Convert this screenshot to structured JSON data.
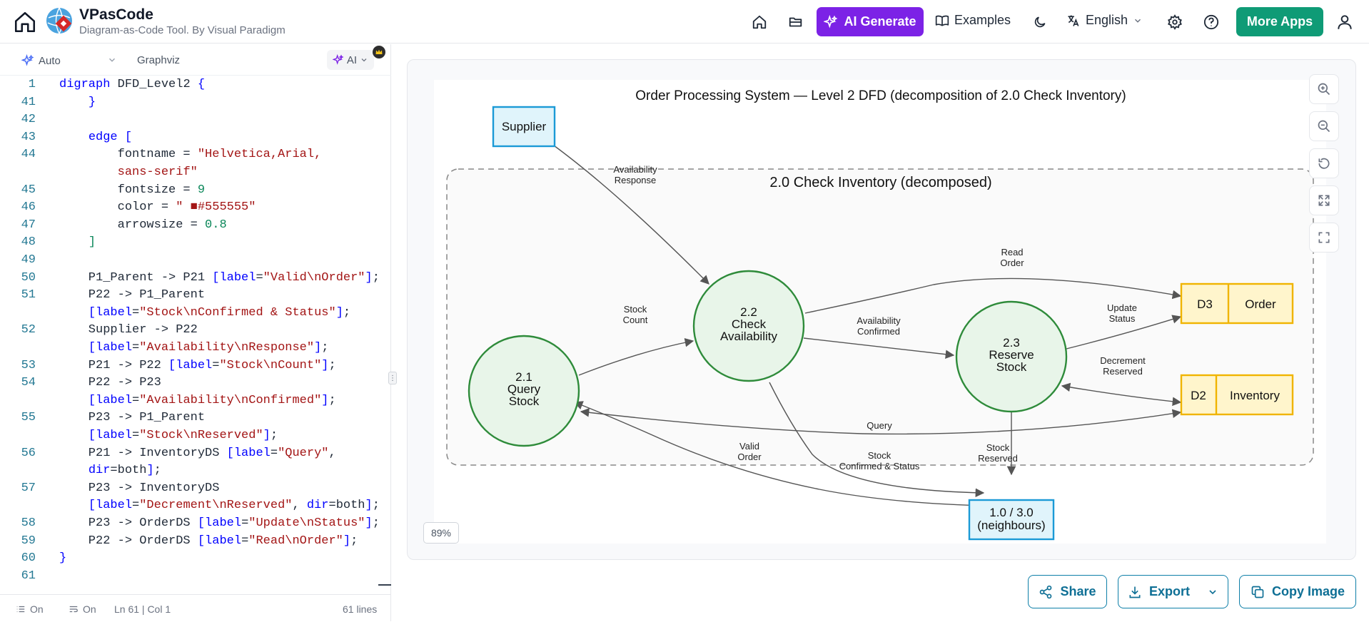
{
  "header": {
    "title": "VPasCode",
    "subtitle": "Diagram-as-Code Tool. By Visual Paradigm",
    "ai_generate": "AI Generate",
    "examples": "Examples",
    "language": "English",
    "more_apps": "More Apps",
    "accent_color": "#7c22e6",
    "more_apps_color": "#0f9b76"
  },
  "editor": {
    "mode": "Auto",
    "engine": "Graphviz",
    "ai": "AI",
    "lines": [
      {
        "n": "1",
        "html": "<span class=\"k\">digraph</span> DFD_Level2 <span class=\"k\">{</span>"
      },
      {
        "n": "41",
        "html": "    <span class=\"k\">}</span>"
      },
      {
        "n": "42",
        "html": ""
      },
      {
        "n": "43",
        "html": "    <span class=\"k\">edge</span> <span class=\"k\">[</span>"
      },
      {
        "n": "44",
        "html": "        fontname = <span class=\"s\">\"Helvetica,Arial,</span>"
      },
      {
        "n": "",
        "html": "        <span class=\"s\">sans-serif\"</span>"
      },
      {
        "n": "45",
        "html": "        fontsize = <span class=\"n\">9</span>"
      },
      {
        "n": "46",
        "html": "        color = <span class=\"s\">\" ■#555555\"</span>"
      },
      {
        "n": "47",
        "html": "        arrowsize = <span class=\"n\">0.8</span>"
      },
      {
        "n": "48",
        "html": "    <span class=\"n\">]</span>"
      },
      {
        "n": "49",
        "html": ""
      },
      {
        "n": "50",
        "html": "    P1_Parent -> P21 <span class=\"k\">[</span><span class=\"at\">label</span>=<span class=\"s\">\"Valid\\nOrder\"</span><span class=\"k\">]</span>;"
      },
      {
        "n": "51",
        "html": "    P22 -> P1_Parent"
      },
      {
        "n": "",
        "html": "    <span class=\"k\">[</span><span class=\"at\">label</span>=<span class=\"s\">\"Stock\\nConfirmed &amp; Status\"</span><span class=\"k\">]</span>;"
      },
      {
        "n": "52",
        "html": "    Supplier -> P22"
      },
      {
        "n": "",
        "html": "    <span class=\"k\">[</span><span class=\"at\">label</span>=<span class=\"s\">\"Availability\\nResponse\"</span><span class=\"k\">]</span>;"
      },
      {
        "n": "53",
        "html": "    P21 -> P22 <span class=\"k\">[</span><span class=\"at\">label</span>=<span class=\"s\">\"Stock\\nCount\"</span><span class=\"k\">]</span>;"
      },
      {
        "n": "54",
        "html": "    P22 -> P23"
      },
      {
        "n": "",
        "html": "    <span class=\"k\">[</span><span class=\"at\">label</span>=<span class=\"s\">\"Availability\\nConfirmed\"</span><span class=\"k\">]</span>;"
      },
      {
        "n": "55",
        "html": "    P23 -> P1_Parent"
      },
      {
        "n": "",
        "html": "    <span class=\"k\">[</span><span class=\"at\">label</span>=<span class=\"s\">\"Stock\\nReserved\"</span><span class=\"k\">]</span>;"
      },
      {
        "n": "56",
        "html": "    P21 -> InventoryDS <span class=\"k\">[</span><span class=\"at\">label</span>=<span class=\"s\">\"Query\"</span>,"
      },
      {
        "n": "",
        "html": "    <span class=\"at\">dir</span>=both<span class=\"k\">]</span>;"
      },
      {
        "n": "57",
        "html": "    P23 -> InventoryDS"
      },
      {
        "n": "",
        "html": "    <span class=\"k\">[</span><span class=\"at\">label</span>=<span class=\"s\">\"Decrement\\nReserved\"</span>, <span class=\"at\">dir</span>=both<span class=\"k\">]</span>;"
      },
      {
        "n": "58",
        "html": "    P23 -> OrderDS <span class=\"k\">[</span><span class=\"at\">label</span>=<span class=\"s\">\"Update\\nStatus\"</span><span class=\"k\">]</span>;"
      },
      {
        "n": "59",
        "html": "    P22 -> OrderDS <span class=\"k\">[</span><span class=\"at\">label</span>=<span class=\"s\">\"Read\\nOrder\"</span><span class=\"k\">]</span>;"
      },
      {
        "n": "60",
        "html": "<span class=\"k\">}</span>"
      },
      {
        "n": "61",
        "html": ""
      }
    ],
    "status": {
      "wrap": "On",
      "format": "On",
      "position": "Ln 61 | Col 1",
      "line_count": "61 lines"
    }
  },
  "diagram": {
    "title": "Order Processing System — Level 2 DFD (decomposition of 2.0 Check Inventory)",
    "cluster_label": "2.0 Check Inventory (decomposed)",
    "supplier": "Supplier",
    "p21": [
      "2.1",
      "Query",
      "Stock"
    ],
    "p22": [
      "2.2",
      "Check",
      "Availability"
    ],
    "p23": [
      "2.3",
      "Reserve",
      "Stock"
    ],
    "d3": [
      "D3",
      "Order"
    ],
    "d2": [
      "D2",
      "Inventory"
    ],
    "parent": [
      "1.0 / 3.0",
      "(neighbours)"
    ],
    "edges": {
      "availability_response": [
        "Availability",
        "Response"
      ],
      "read_order": [
        "Read",
        "Order"
      ],
      "stock_count": [
        "Stock",
        "Count"
      ],
      "availability_confirmed": [
        "Availability",
        "Confirmed"
      ],
      "update_status": [
        "Update",
        "Status"
      ],
      "decrement_reserved": [
        "Decrement",
        "Reserved"
      ],
      "query": "Query",
      "valid_order": [
        "Valid",
        "Order"
      ],
      "stock_confirmed": [
        "Stock",
        "Confirmed & Status"
      ],
      "stock_reserved": [
        "Stock",
        "Reserved"
      ]
    },
    "colors": {
      "process_fill": "#e8f5e9",
      "process_stroke": "#2e8b3a",
      "external_fill": "#e0f4fb",
      "external_stroke": "#1b9ad6",
      "store_fill": "#fff5cc",
      "store_stroke": "#f0b400",
      "edge": "#555555"
    },
    "zoom": "89%"
  },
  "actions": {
    "share": "Share",
    "export": "Export",
    "copy_image": "Copy Image"
  }
}
